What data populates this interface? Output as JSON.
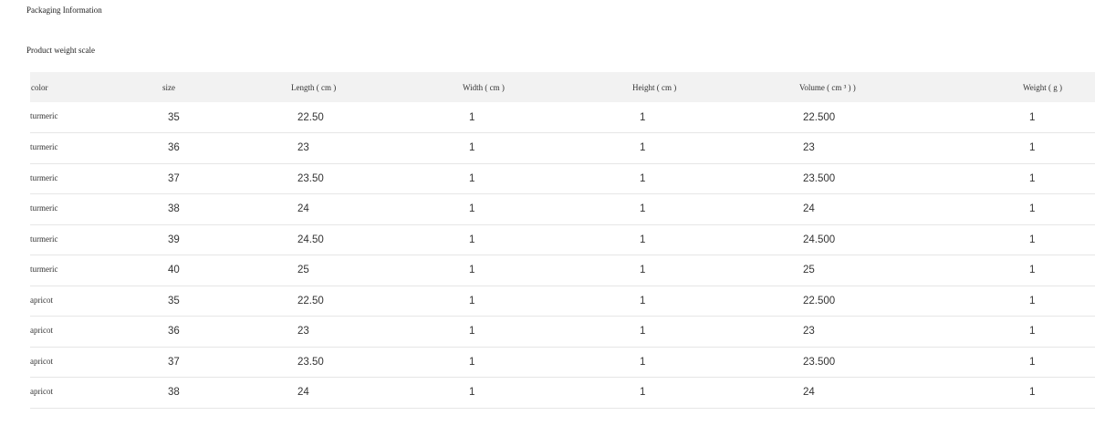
{
  "page": {
    "title": "Packaging Information",
    "section_title": "Product weight scale"
  },
  "table": {
    "headers": [
      "color",
      "size",
      "Length ( cm )",
      "Width ( cm )",
      "Height ( cm )",
      "Volume ( cm ³ ) )",
      "Weight ( g )"
    ],
    "rows": [
      [
        "turmeric",
        "35",
        "22.50",
        "1",
        "1",
        "22.500",
        "1"
      ],
      [
        "turmeric",
        "36",
        "23",
        "1",
        "1",
        "23",
        "1"
      ],
      [
        "turmeric",
        "37",
        "23.50",
        "1",
        "1",
        "23.500",
        "1"
      ],
      [
        "turmeric",
        "38",
        "24",
        "1",
        "1",
        "24",
        "1"
      ],
      [
        "turmeric",
        "39",
        "24.50",
        "1",
        "1",
        "24.500",
        "1"
      ],
      [
        "turmeric",
        "40",
        "25",
        "1",
        "1",
        "25",
        "1"
      ],
      [
        "apricot",
        "35",
        "22.50",
        "1",
        "1",
        "22.500",
        "1"
      ],
      [
        "apricot",
        "36",
        "23",
        "1",
        "1",
        "23",
        "1"
      ],
      [
        "apricot",
        "37",
        "23.50",
        "1",
        "1",
        "23.500",
        "1"
      ],
      [
        "apricot",
        "38",
        "24",
        "1",
        "1",
        "24",
        "1"
      ]
    ]
  }
}
